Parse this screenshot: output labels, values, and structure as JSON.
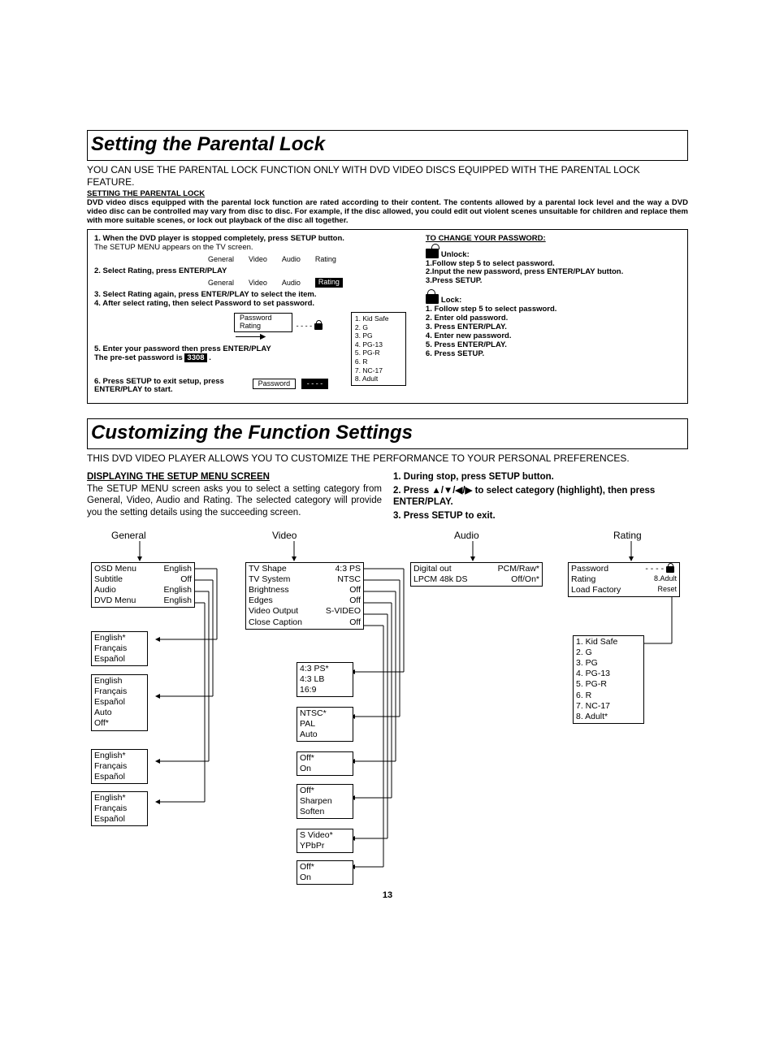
{
  "section1": {
    "title": "Setting the Parental Lock",
    "intro": "YOU CAN USE THE PARENTAL LOCK FUNCTION ONLY WITH DVD VIDEO DISCS EQUIPPED WITH THE PARENTAL LOCK FEATURE.",
    "sub_heading": "SETTING THE PARENTAL LOCK",
    "desc": "DVD video discs equipped with the parental lock function are rated according to their content.  The contents allowed by a parental lock level and the way a DVD video disc can be controlled may vary from disc to disc.  For example, if the disc allowed, you could edit out violent scenes unsuitable for children and replace them with more suitable scenes, or lock out playback of the disc all together.",
    "left": {
      "s1a": "1. When the DVD player is stopped completely, press SETUP button.",
      "s1b": "The SETUP MENU appears on the TV screen.",
      "tabs": [
        "General",
        "Video",
        "Audio",
        "Rating"
      ],
      "s2": "2. Select Rating, press ENTER/PLAY",
      "s3": "3. Select Rating again, press ENTER/PLAY to select the item.",
      "s4": "4. After select rating, then select Password to set password.",
      "s5a": "5. Enter your password then press ENTER/PLAY",
      "s5b_pre": "The pre-set password is",
      "s5b_code": "3308",
      "s5b_post": ".",
      "s6a": "6. Press SETUP to exit setup, press",
      "s6b": "ENTER/PLAY to start.",
      "pw_box_a": "Password",
      "pw_box_b": "Rating",
      "pw_dashes": "- - - -",
      "ratings": [
        "1. Kid Safe",
        "2. G",
        "3. PG",
        "4. PG-13",
        "5. PG-R",
        "6. R",
        "7. NC-17",
        "8. Adult"
      ]
    },
    "right": {
      "heading": "TO CHANGE YOUR PASSWORD:",
      "unlock_title": "Unlock:",
      "unlock_steps": [
        "1.Follow step 5 to select password.",
        "2.Input the new password, press ENTER/PLAY button.",
        "3.Press SETUP."
      ],
      "lock_title": "Lock:",
      "lock_steps": [
        "1. Follow step 5 to select password.",
        "2. Enter old password.",
        "3. Press ENTER/PLAY.",
        "4. Enter new password.",
        "5. Press ENTER/PLAY.",
        "6. Press SETUP."
      ]
    }
  },
  "section2": {
    "title": "Customizing the Function Settings",
    "intro": "THIS DVD VIDEO PLAYER ALLOWS YOU TO CUSTOMIZE THE PERFORMANCE TO YOUR PERSONAL PREFERENCES.",
    "left_heading": "DISPLAYING THE SETUP MENU SCREEN",
    "left_desc": "The SETUP MENU screen asks you to select a setting category from General, Video, Audio and Rating. The selected category will provide you the setting details using the succeeding screen.",
    "right_steps": {
      "s1": "1. During stop, press SETUP button.",
      "s2a": "2. Press ",
      "s2b": "▲/▼/◀/▶",
      "s2c": " to select category (highlight), then press ENTER/PLAY.",
      "s3": "3. Press SETUP to exit."
    },
    "categories": [
      "General",
      "Video",
      "Audio",
      "Rating"
    ],
    "general_box": [
      [
        "OSD Menu",
        "English"
      ],
      [
        "Subtitle",
        "Off"
      ],
      [
        "Audio",
        "English"
      ],
      [
        "DVD Menu",
        "English"
      ]
    ],
    "general_opts": {
      "a": [
        "English*",
        "Français",
        "Español"
      ],
      "b": [
        "English",
        "Français",
        "Español",
        "Auto",
        "Off*"
      ],
      "c": [
        "English*",
        "Français",
        "Español"
      ],
      "d": [
        "English*",
        "Français",
        "Español"
      ]
    },
    "video_box": [
      [
        "TV Shape",
        "4:3   PS"
      ],
      [
        "TV System",
        "NTSC"
      ],
      [
        "Brightness",
        "Off"
      ],
      [
        "Edges",
        "Off"
      ],
      [
        "Video Output",
        "S-VIDEO"
      ],
      [
        "Close Caption",
        "Off"
      ]
    ],
    "video_opts": {
      "a": [
        "4:3   PS*",
        "4:3   LB",
        "16:9"
      ],
      "b": [
        "NTSC*",
        "PAL",
        "Auto"
      ],
      "c": [
        "Off*",
        "On"
      ],
      "d": [
        "Off*",
        "Sharpen",
        "Soften"
      ],
      "e": [
        "S Video*",
        "YPbPr"
      ],
      "f": [
        "Off*",
        "On"
      ]
    },
    "audio_box": [
      [
        "Digital out",
        "PCM/Raw*"
      ],
      [
        "LPCM 48k DS",
        "Off/On*"
      ]
    ],
    "rating_box": [
      [
        "Password",
        "- - - -"
      ],
      [
        "Rating",
        "8.Adult"
      ],
      [
        "Load Factory",
        "Reset"
      ]
    ],
    "rating_opts": [
      "1. Kid Safe",
      "2. G",
      "3. PG",
      "4. PG-13",
      "5. PG-R",
      "6. R",
      "7. NC-17",
      "8. Adult*"
    ]
  },
  "page_number": "13"
}
